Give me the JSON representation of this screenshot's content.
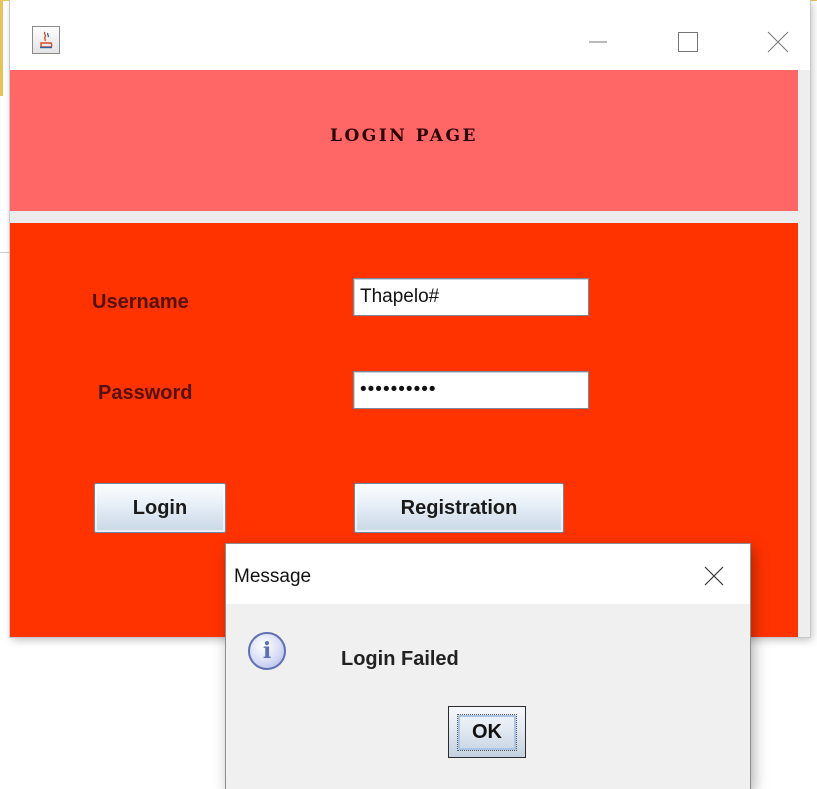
{
  "window": {
    "title": "",
    "controls": [
      "minimize-icon",
      "maximize-icon",
      "close-icon"
    ]
  },
  "header": {
    "title": "LOGIN PAGE"
  },
  "form": {
    "username_label": "Username",
    "username_value": "Thapelo#",
    "password_label": "Password",
    "password_value": "••••••••••"
  },
  "buttons": {
    "login": "Login",
    "registration": "Registration"
  },
  "dialog": {
    "title": "Message",
    "icon": "info-icon",
    "message": "Login Failed",
    "ok": "OK"
  },
  "colors": {
    "header_bg": "#ff6666",
    "body_bg": "#ff3300",
    "label_text": "#551111"
  }
}
